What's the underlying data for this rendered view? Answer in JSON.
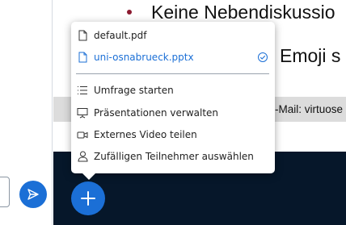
{
  "slide": {
    "line1": "Keine Nebendiskussio",
    "line2": "Emoji s",
    "band_text": "-Mail: virtuose"
  },
  "actions_menu": {
    "presentations": [
      {
        "label": "default.pdf",
        "icon": "document-icon",
        "active": false
      },
      {
        "label": "uni-osnabrueck.pptx",
        "icon": "document-icon",
        "active": true
      }
    ],
    "actions": [
      {
        "label": "Umfrage starten",
        "icon": "poll-icon"
      },
      {
        "label": "Präsentationen verwalten",
        "icon": "presentation-icon"
      },
      {
        "label": "Externes Video teilen",
        "icon": "video-icon"
      },
      {
        "label": "Zufälligen Teilnehmer auswählen",
        "icon": "user-icon"
      }
    ]
  },
  "colors": {
    "accent": "#1b6fd6",
    "bar": "#06172a",
    "bullet": "#8b1a30",
    "band": "#dcdcdc"
  }
}
